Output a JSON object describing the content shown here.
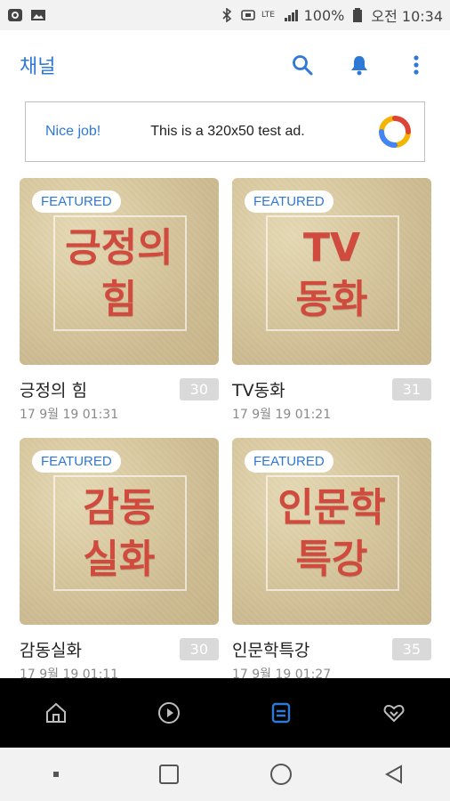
{
  "status_bar": {
    "battery": "100%",
    "time": "오전 10:34"
  },
  "app_bar": {
    "title": "채널",
    "icons": [
      "search-icon",
      "bell-icon",
      "more-vert-icon"
    ]
  },
  "ad": {
    "left_text": "Nice job!",
    "main_text": "This is a 320x50 test ad."
  },
  "cards": [
    {
      "badge": "FEATURED",
      "thumb_text": "긍정의\n힘",
      "name": "긍정의 힘",
      "count": "30",
      "time": "17 9월 19 01:31"
    },
    {
      "badge": "FEATURED",
      "thumb_text": "TV\n동화",
      "name": "TV동화",
      "count": "31",
      "time": "17 9월 19 01:21"
    },
    {
      "badge": "FEATURED",
      "thumb_text": "감동\n실화",
      "name": "감동실화",
      "count": "30",
      "time": "17 9월 19 01:11"
    },
    {
      "badge": "FEATURED",
      "thumb_text": "인문학\n특강",
      "name": "인문학특강",
      "count": "35",
      "time": "17 9월 19 01:27"
    }
  ],
  "bottom_nav": {
    "items": [
      "home-icon",
      "play-icon",
      "channel-icon",
      "favorite-icon"
    ],
    "active_index": 2,
    "accent": "#2f79d6"
  },
  "system_nav": {
    "items": [
      "recent-dot-icon",
      "overview-square-icon",
      "home-circle-icon",
      "back-triangle-icon"
    ]
  },
  "colors": {
    "accent": "#2f79d6",
    "thumb_text": "#d04a3e",
    "count_bg": "#d9d9d9"
  }
}
